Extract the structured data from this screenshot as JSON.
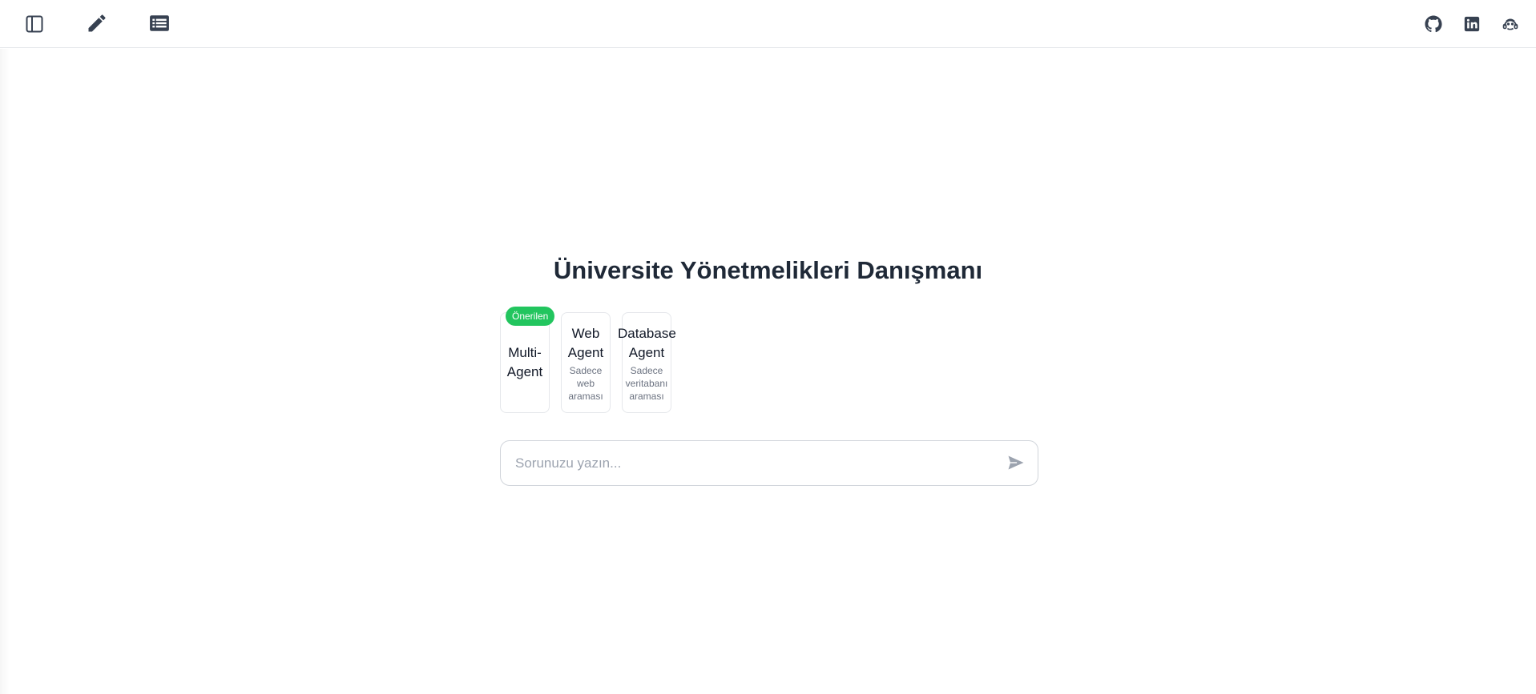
{
  "header": {
    "left_icons": [
      "sidebar-toggle-icon",
      "pencil-icon",
      "list-icon"
    ],
    "right_icons": [
      "github-icon",
      "linkedin-icon",
      "kaggle-icon"
    ],
    "icon_color": "#374151"
  },
  "main": {
    "title": "Üniversite Yönetmelikleri Danışmanı",
    "agents": [
      {
        "label": "Multi-Agent",
        "line1": "Multi-",
        "line2": "Agent",
        "badge": "Önerilen",
        "description": ""
      },
      {
        "label": "Web Agent",
        "line1": "Web",
        "line2": "Agent",
        "badge": "",
        "desc1": "Sadece",
        "desc2": "web",
        "desc3": "araması"
      },
      {
        "label": "Database Agent",
        "line1": "Database",
        "line2": "Agent",
        "badge": "",
        "desc1": "Sadece",
        "desc2": "veritabanı",
        "desc3": "araması"
      }
    ],
    "badge_color": "#22c55e",
    "chat_input": {
      "placeholder": "Sorunuzu yazın...",
      "value": ""
    },
    "send_icon": "send-icon"
  }
}
